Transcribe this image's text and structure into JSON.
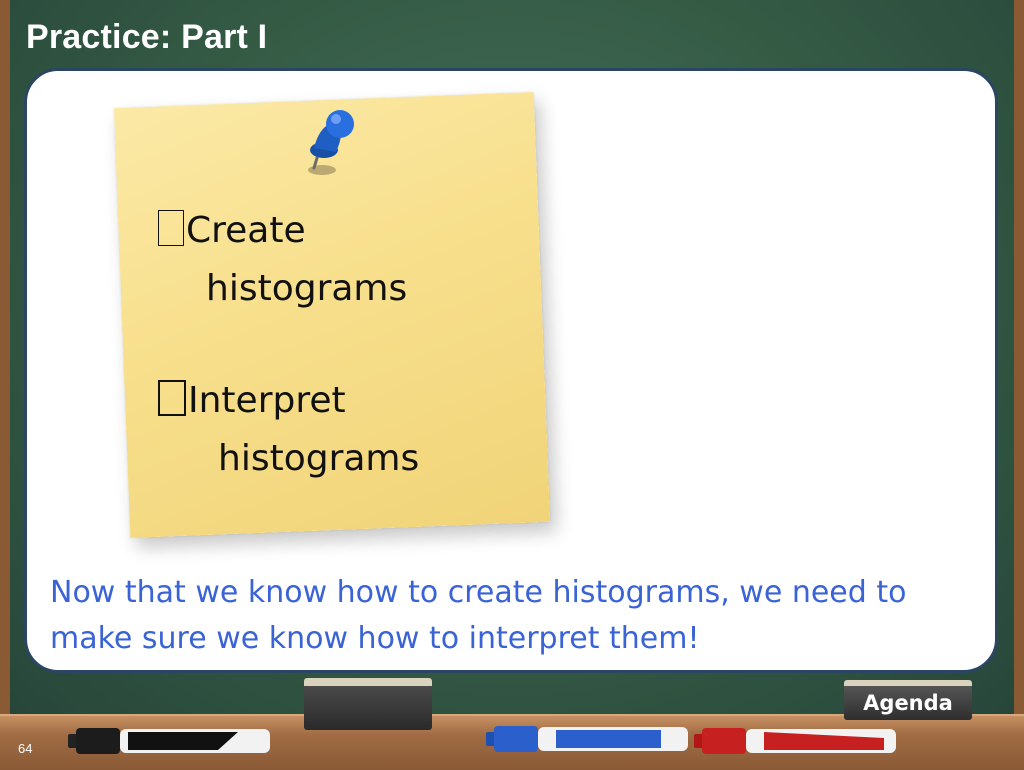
{
  "slide": {
    "title": "Practice: Part I",
    "page_number": "64"
  },
  "note": {
    "items": [
      {
        "line1": "Create",
        "line2": "histograms",
        "checked": false
      },
      {
        "line1": "Interpret",
        "line2": "histograms",
        "checked": false
      }
    ]
  },
  "body": {
    "text": "Now that we know how to create histograms, we need to make sure we know how to interpret them!"
  },
  "nav": {
    "agenda_label": "Agenda"
  },
  "colors": {
    "title": "#ffffff",
    "body_text": "#3a63d6",
    "panel_border": "#2a4662",
    "board": "#345a44",
    "note": "#f7df8c",
    "pin": "#1f5fc4"
  },
  "icons": [
    "checkbox-icon",
    "pushpin-icon",
    "marker-black-icon",
    "marker-blue-icon",
    "marker-red-icon"
  ]
}
